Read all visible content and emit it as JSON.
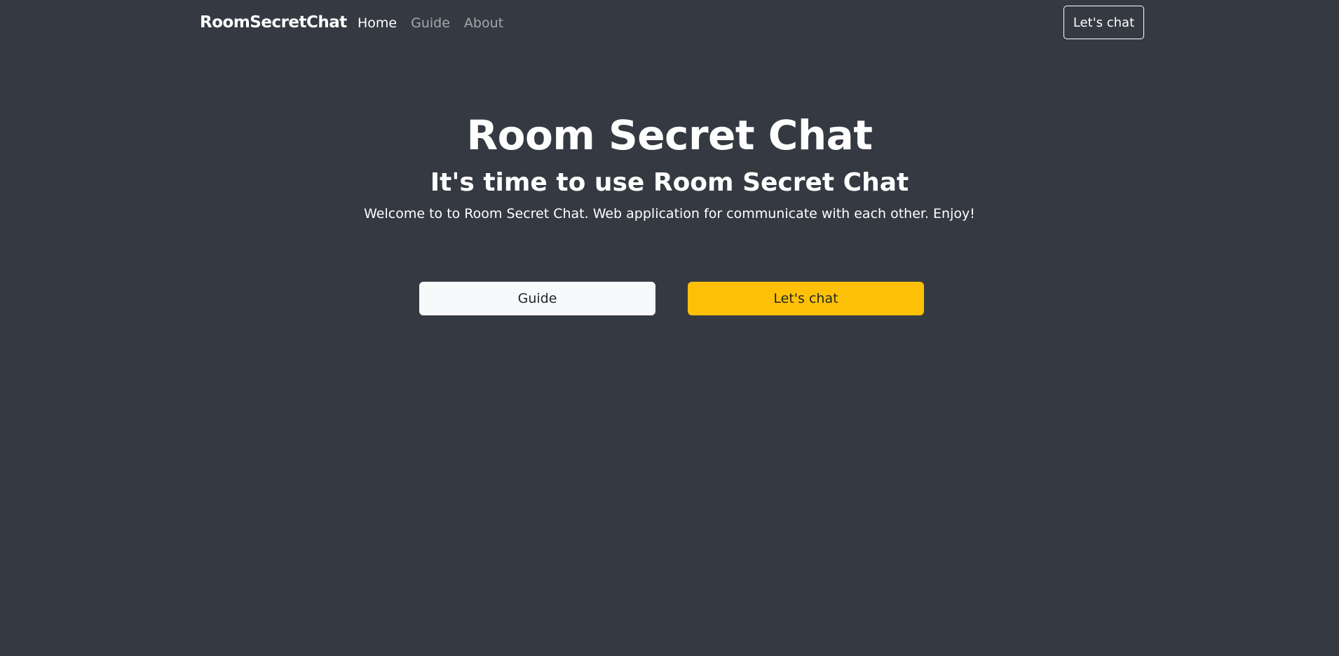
{
  "navbar": {
    "brand": "RoomSecretChat",
    "links": [
      {
        "label": "Home"
      },
      {
        "label": "Guide"
      },
      {
        "label": "About"
      }
    ],
    "cta_label": "Let's chat"
  },
  "hero": {
    "title": "Room Secret Chat",
    "subtitle": "It's time to use Room Secret Chat",
    "lead": "Welcome to to Room Secret Chat. Web application for communicate with each other. Enjoy!"
  },
  "actions": {
    "guide_label": "Guide",
    "chat_label": "Let's chat"
  },
  "colors": {
    "background": "#353a42",
    "text": "#ffffff",
    "nav_inactive": "rgba(255,255,255,0.55)",
    "light_button": "#f8f9fa",
    "warning_button": "#ffc107",
    "button_text": "#212529"
  }
}
